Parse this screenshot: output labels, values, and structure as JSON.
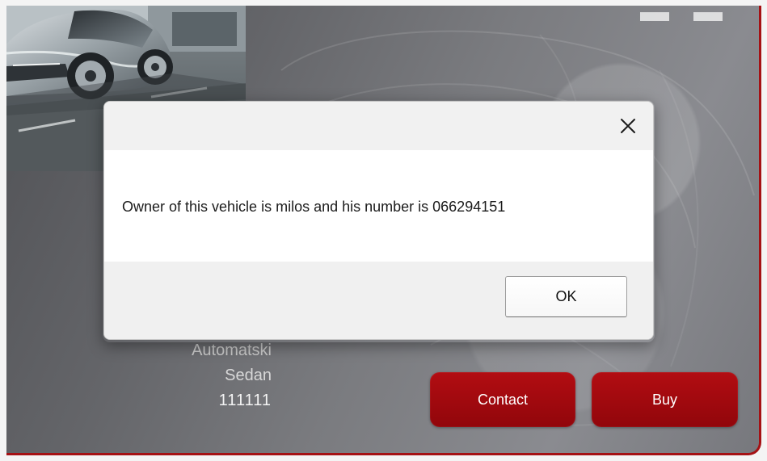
{
  "dialog": {
    "close_icon": "close-icon",
    "message": "Owner of this vehicle is milos and his number is 066294151",
    "ok_label": "OK"
  },
  "vehicle": {
    "transmission": "Automatski",
    "body_type": "Sedan",
    "number": "111111"
  },
  "actions": {
    "contact_label": "Contact",
    "buy_label": "Buy"
  },
  "colors": {
    "accent_red": "#a51114",
    "button_red": "#9d0a0f",
    "dialog_background": "#ffffff",
    "dialog_footer": "#f0f0f0"
  }
}
